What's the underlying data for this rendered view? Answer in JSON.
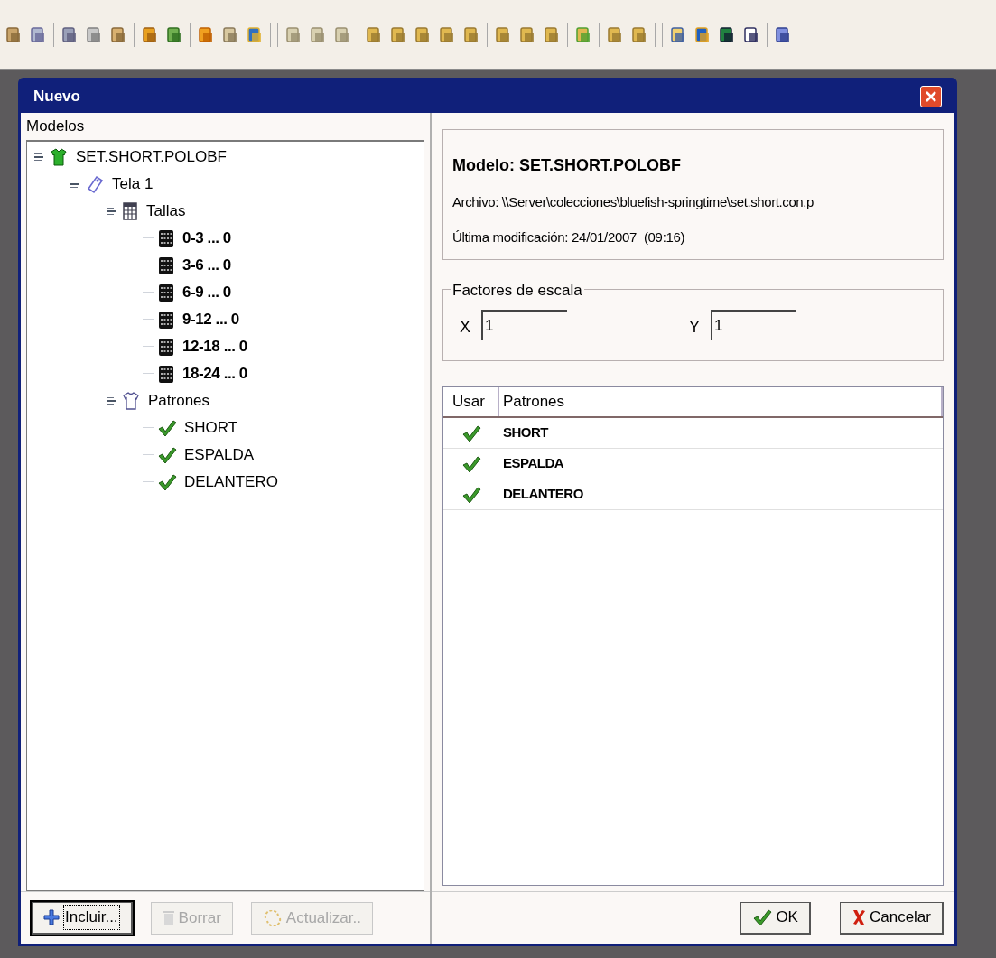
{
  "window": {
    "title": "Nuevo"
  },
  "tree": {
    "label": "Modelos",
    "items": [
      {
        "kind": "model",
        "label": "SET.SHORT.POLOBF",
        "expanded": true,
        "children": [
          {
            "kind": "fabric",
            "label": "Tela 1",
            "expanded": true,
            "children": [
              {
                "kind": "sizes",
                "label": "Tallas",
                "expanded": true,
                "children": [
                  {
                    "kind": "size",
                    "label": "0-3 ... 0"
                  },
                  {
                    "kind": "size",
                    "label": "3-6 ... 0"
                  },
                  {
                    "kind": "size",
                    "label": "6-9 ... 0"
                  },
                  {
                    "kind": "size",
                    "label": "9-12 ... 0"
                  },
                  {
                    "kind": "size",
                    "label": "12-18 ... 0"
                  },
                  {
                    "kind": "size",
                    "label": "18-24 ... 0"
                  }
                ]
              },
              {
                "kind": "patterns",
                "label": "Patrones",
                "expanded": true,
                "children": [
                  {
                    "kind": "pattern",
                    "label": "SHORT"
                  },
                  {
                    "kind": "pattern",
                    "label": "ESPALDA"
                  },
                  {
                    "kind": "pattern",
                    "label": "DELANTERO"
                  }
                ]
              }
            ]
          }
        ]
      }
    ]
  },
  "info": {
    "model": "Modelo: SET.SHORT.POLOBF",
    "file": "Archivo: \\\\Server\\colecciones\\bluefish-springtime\\set.short.con.p",
    "modified": "Última modificación: 24/01/2007  (09:16)"
  },
  "scale": {
    "label": "Factores de escala",
    "x_label": "X",
    "x_value": "1",
    "y_label": "Y",
    "y_value": "1"
  },
  "table": {
    "columns": [
      "Usar",
      "Patrones"
    ],
    "rows": [
      {
        "checked": true,
        "name": "SHORT"
      },
      {
        "checked": true,
        "name": "ESPALDA"
      },
      {
        "checked": true,
        "name": "DELANTERO"
      }
    ]
  },
  "left_buttons": [
    {
      "kind": "add",
      "label": "Incluir...",
      "disabled": false
    },
    {
      "kind": "delete",
      "label": "Borrar",
      "disabled": true
    },
    {
      "kind": "refresh",
      "label": "Actualizar..",
      "disabled": true
    }
  ],
  "right_buttons": [
    {
      "kind": "ok",
      "label": "OK",
      "disabled": false
    },
    {
      "kind": "cancel",
      "label": "Cancelar",
      "disabled": false
    }
  ]
}
